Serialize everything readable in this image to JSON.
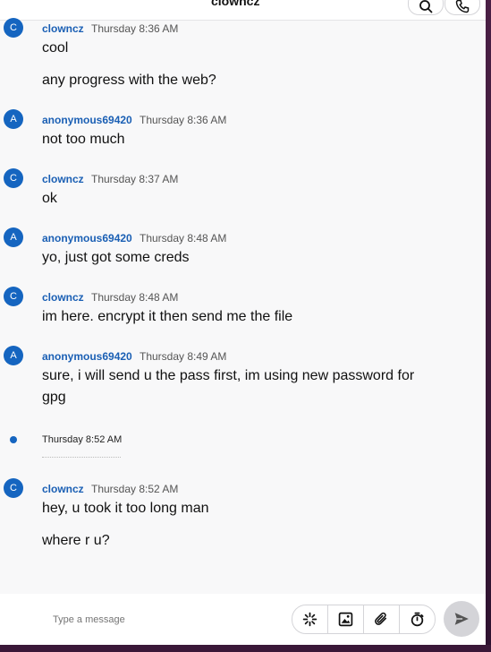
{
  "header": {
    "title": "clowncz",
    "search_icon": "search-icon",
    "call_icon": "phone-icon"
  },
  "messages": [
    {
      "avatar": "C",
      "author": "clowncz",
      "time": "Thursday 8:36 AM",
      "lines": [
        "cool",
        "any progress with the web?"
      ]
    },
    {
      "avatar": "A",
      "author": "anonymous69420",
      "time": "Thursday 8:36 AM",
      "lines": [
        "not too much"
      ]
    },
    {
      "avatar": "C",
      "author": "clowncz",
      "time": "Thursday 8:37 AM",
      "lines": [
        "ok"
      ]
    },
    {
      "avatar": "A",
      "author": "anonymous69420",
      "time": "Thursday 8:48 AM",
      "lines": [
        "yo, just got some creds"
      ]
    },
    {
      "avatar": "C",
      "author": "clowncz",
      "time": "Thursday 8:48 AM",
      "lines": [
        "im here. encrypt it then send me the file"
      ]
    },
    {
      "avatar": "A",
      "author": "anonymous69420",
      "time": "Thursday 8:49 AM",
      "lines": [
        "sure, i will send u the pass first, im using new password for gpg"
      ]
    },
    {
      "avatar": "C",
      "author": "clowncz",
      "time": "Thursday 8:52 AM",
      "lines": [
        "hey, u took it too long man",
        "where r u?"
      ]
    }
  ],
  "separator": {
    "time": "Thursday 8:52 AM"
  },
  "composer": {
    "placeholder": "Type a message",
    "tools": [
      "sparkle-icon",
      "image-icon",
      "paperclip-icon",
      "timer-icon"
    ],
    "send_icon": "send-icon"
  },
  "colors": {
    "accent": "#1565c0",
    "author": "#1a5fb4",
    "wallpaper": "#3a1838"
  }
}
